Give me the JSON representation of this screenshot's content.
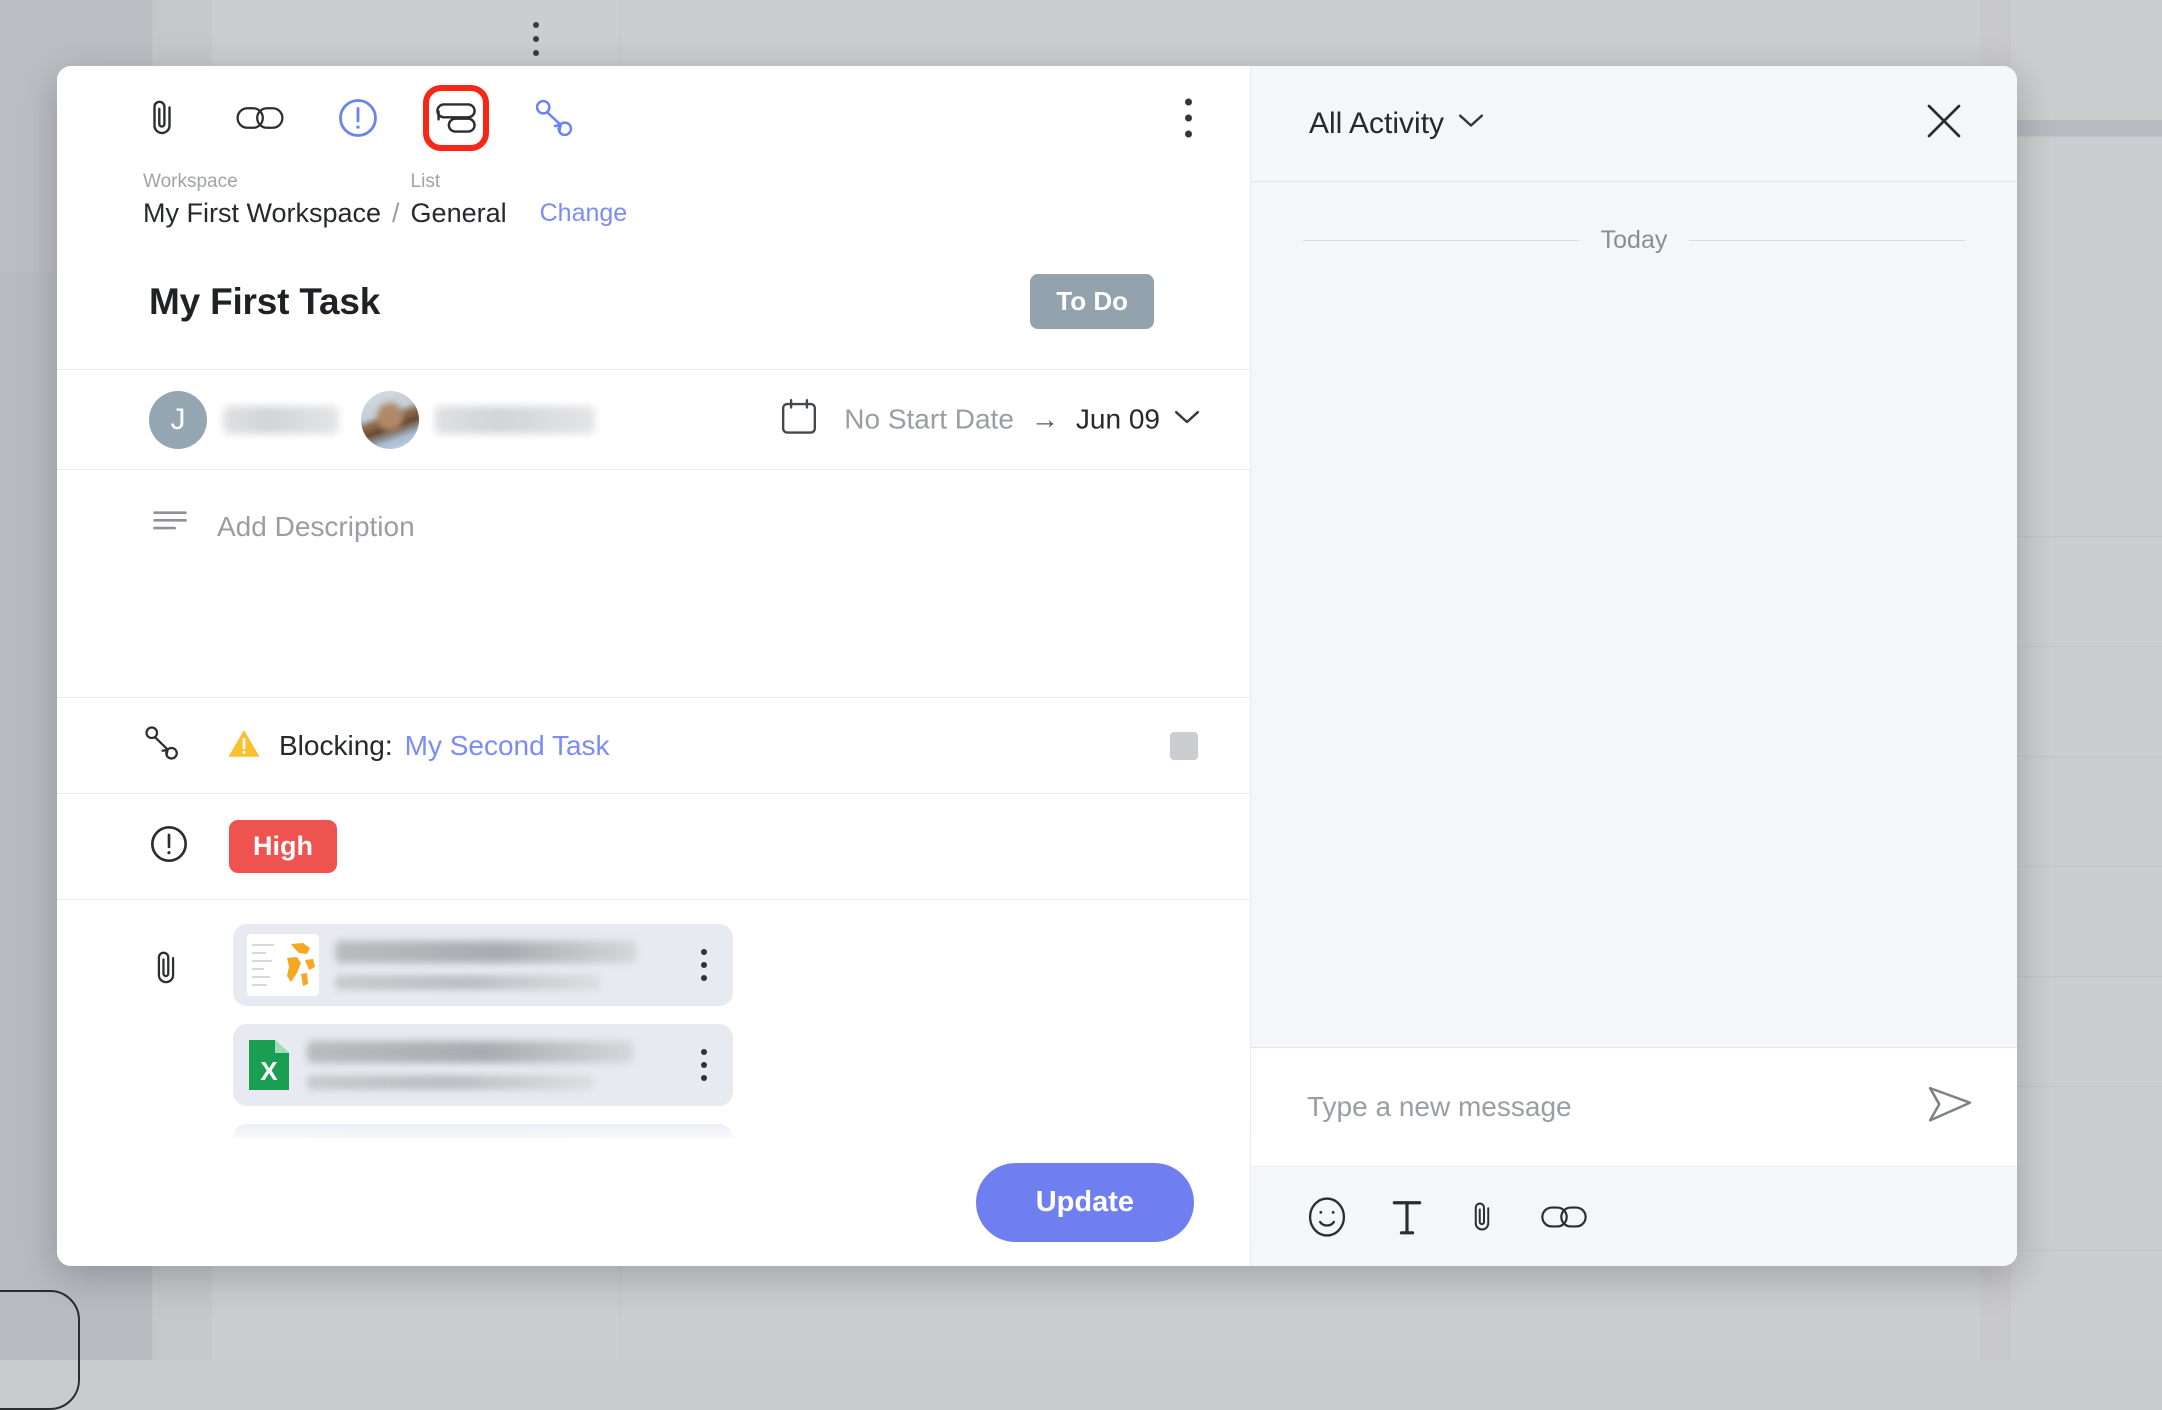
{
  "modal": {
    "toolbar": {
      "icons": [
        {
          "name": "attachment-icon",
          "label": "Attachment"
        },
        {
          "name": "link-icon",
          "label": "Link"
        },
        {
          "name": "priority-icon",
          "label": "Priority"
        },
        {
          "name": "subtask-icon",
          "label": "Subtask"
        },
        {
          "name": "dependency-icon",
          "label": "Dependency"
        }
      ],
      "more_label": "More options"
    },
    "breadcrumb": {
      "workspace_caption": "Workspace",
      "workspace_value": "My First Workspace",
      "separator": "/",
      "list_caption": "List",
      "list_value": "General",
      "change_label": "Change"
    },
    "task": {
      "title": "My First Task",
      "status": "To Do"
    },
    "assignees": [
      {
        "initial": "J",
        "type": "initial"
      },
      {
        "initial": "",
        "type": "photo"
      }
    ],
    "dates": {
      "start": "No Start Date",
      "arrow": "→",
      "due": "Jun 09"
    },
    "description": {
      "placeholder": "Add Description"
    },
    "dependency": {
      "label": "Blocking:",
      "task_link": "My Second Task"
    },
    "priority": {
      "value": "High",
      "color": "#ef5350"
    },
    "attachments": [
      {
        "type": "image",
        "icon": "map-thumbnail"
      },
      {
        "type": "xlsx",
        "icon": "excel-file-icon"
      },
      {
        "type": "docx",
        "icon": "word-file-icon"
      }
    ],
    "footer": {
      "update_label": "Update"
    }
  },
  "activity": {
    "title": "All Activity",
    "close_label": "Close",
    "day_divider": "Today",
    "composer": {
      "placeholder": "Type a new message",
      "send_label": "Send",
      "tools": [
        {
          "name": "emoji-icon",
          "label": "Emoji"
        },
        {
          "name": "text-format-icon",
          "label": "Text formatting"
        },
        {
          "name": "attachment-icon",
          "label": "Attach file"
        },
        {
          "name": "link-icon",
          "label": "Insert link"
        }
      ]
    }
  },
  "colors": {
    "accent": "#707ff0",
    "link": "#7b8cf5",
    "status_badge": "#92a3ad",
    "priority_high": "#ef5350",
    "highlight_outline": "#f72717"
  }
}
